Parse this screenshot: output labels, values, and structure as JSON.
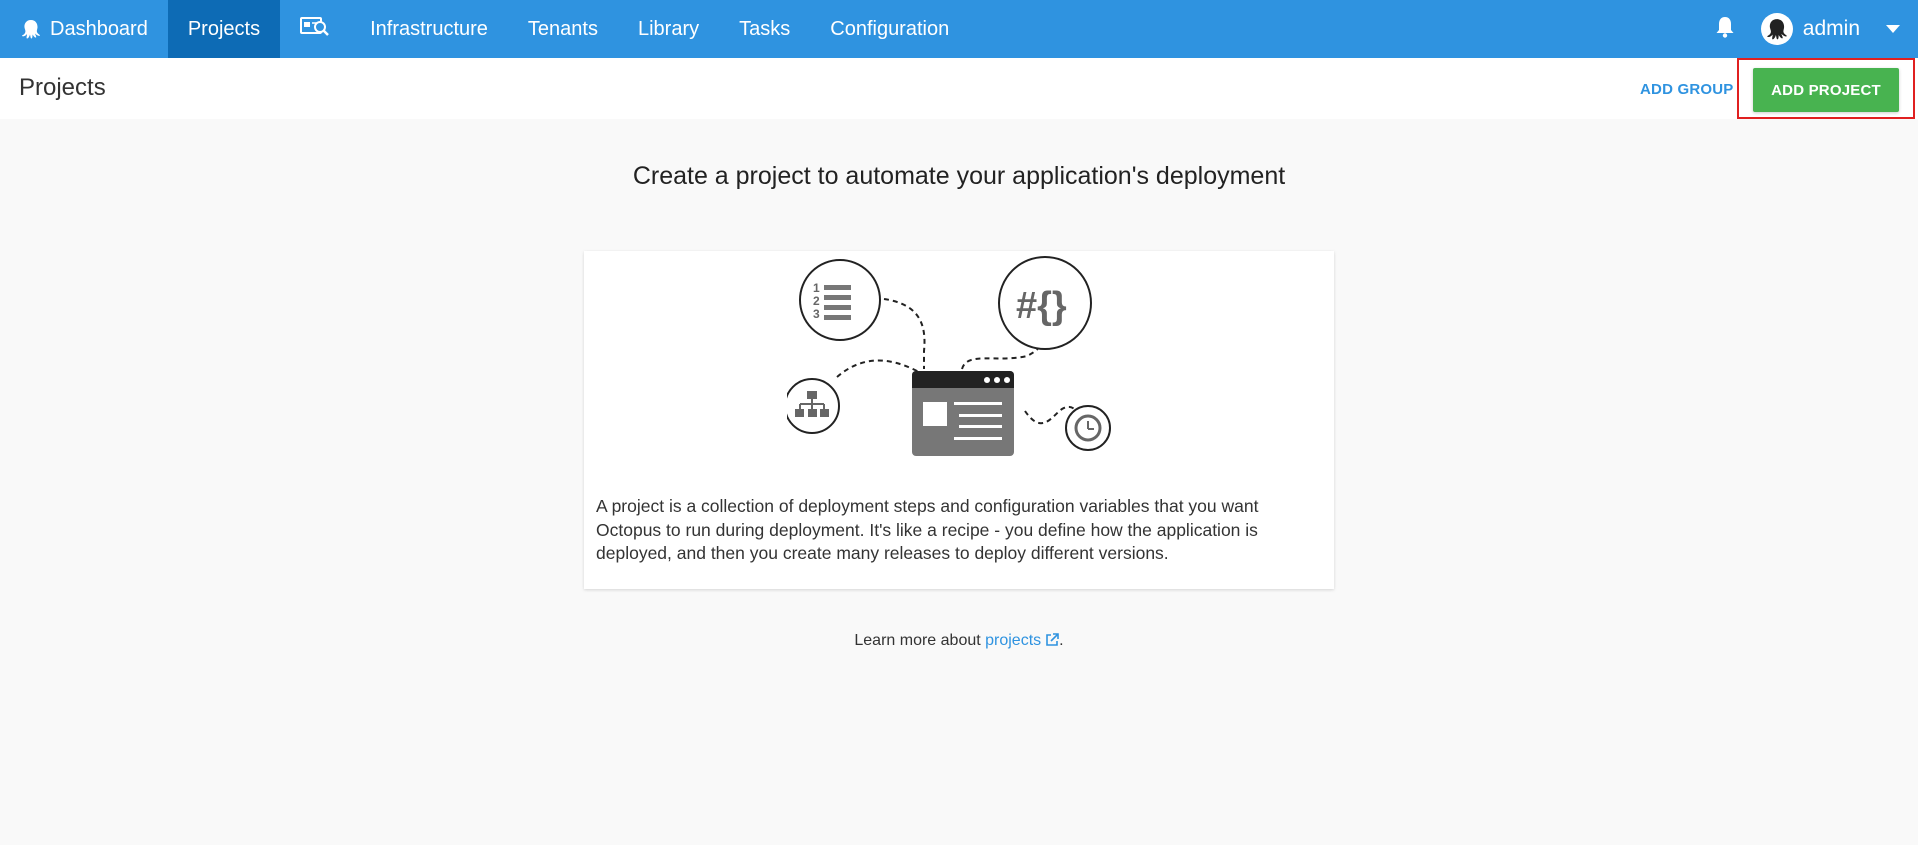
{
  "nav": {
    "dashboard": "Dashboard",
    "projects": "Projects",
    "infrastructure": "Infrastructure",
    "tenants": "Tenants",
    "library": "Library",
    "tasks": "Tasks",
    "configuration": "Configuration",
    "user": "admin"
  },
  "header": {
    "title": "Projects",
    "add_group": "ADD GROUP",
    "add_project": "ADD PROJECT"
  },
  "main": {
    "headline": "Create a project to automate your application's deployment",
    "description": "A project is a collection of deployment steps and configuration variables that you want Octopus to run during deployment. It's like a recipe - you define how the application is deployed, and then you create many releases to deploy different versions.",
    "learn_prefix": "Learn more about ",
    "learn_link": "projects",
    "learn_suffix": "."
  },
  "colors": {
    "nav_bg": "#2f93e0",
    "nav_active": "#0d6bb5",
    "primary_button": "#48b350",
    "link": "#2f93e0",
    "highlight_border": "#e02020"
  },
  "icons": [
    "octopus-logo-icon",
    "audit-search-icon",
    "bell-icon",
    "user-avatar-icon",
    "caret-down-icon",
    "external-link-icon"
  ]
}
